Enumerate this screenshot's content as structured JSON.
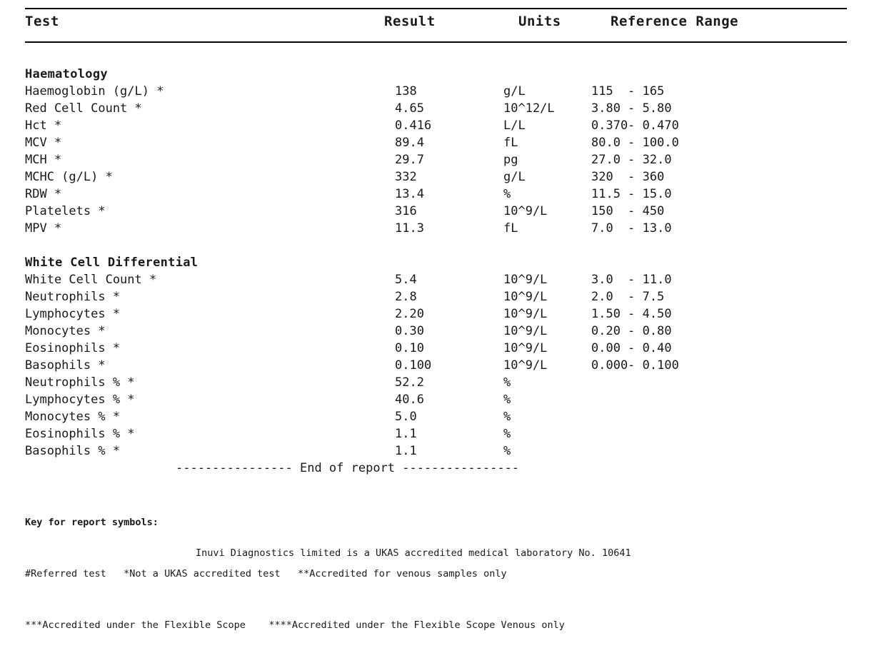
{
  "table": {
    "headers": {
      "test": "Test",
      "result": "Result",
      "units": "Units",
      "reference_range": "Reference Range"
    }
  },
  "sections": [
    {
      "title": "Haematology",
      "rows": [
        {
          "test": "Haemoglobin (g/L) *",
          "result": "138",
          "units": "g/L",
          "range": "115  - 165"
        },
        {
          "test": "Red Cell Count *",
          "result": "4.65",
          "units": "10^12/L",
          "range": "3.80 - 5.80"
        },
        {
          "test": "Hct *",
          "result": "0.416",
          "units": "L/L",
          "range": "0.370- 0.470"
        },
        {
          "test": "MCV *",
          "result": "89.4",
          "units": "fL",
          "range": "80.0 - 100.0"
        },
        {
          "test": "MCH *",
          "result": "29.7",
          "units": "pg",
          "range": "27.0 - 32.0"
        },
        {
          "test": "MCHC (g/L) *",
          "result": "332",
          "units": "g/L",
          "range": "320  - 360"
        },
        {
          "test": "RDW *",
          "result": "13.4",
          "units": "%",
          "range": "11.5 - 15.0"
        },
        {
          "test": "Platelets *",
          "result": "316",
          "units": "10^9/L",
          "range": "150  - 450"
        },
        {
          "test": "MPV *",
          "result": "11.3",
          "units": "fL",
          "range": "7.0  - 13.0"
        }
      ]
    },
    {
      "title": "White Cell Differential",
      "rows": [
        {
          "test": "White Cell Count *",
          "result": "5.4",
          "units": "10^9/L",
          "range": "3.0  - 11.0"
        },
        {
          "test": "Neutrophils *",
          "result": "2.8",
          "units": "10^9/L",
          "range": "2.0  - 7.5"
        },
        {
          "test": "Lymphocytes *",
          "result": "2.20",
          "units": "10^9/L",
          "range": "1.50 - 4.50"
        },
        {
          "test": "Monocytes *",
          "result": "0.30",
          "units": "10^9/L",
          "range": "0.20 - 0.80"
        },
        {
          "test": "Eosinophils *",
          "result": "0.10",
          "units": "10^9/L",
          "range": "0.00 - 0.40"
        },
        {
          "test": "Basophils *",
          "result": "0.100",
          "units": "10^9/L",
          "range": "0.000- 0.100"
        },
        {
          "test": "Neutrophils % *",
          "result": "52.2",
          "units": "%",
          "range": ""
        },
        {
          "test": "Lymphocytes % *",
          "result": "40.6",
          "units": "%",
          "range": ""
        },
        {
          "test": "Monocytes % *",
          "result": "5.0",
          "units": "%",
          "range": ""
        },
        {
          "test": "Eosinophils % *",
          "result": "1.1",
          "units": "%",
          "range": ""
        },
        {
          "test": "Basophils % *",
          "result": "1.1",
          "units": "%",
          "range": ""
        }
      ]
    }
  ],
  "end_of_report": "---------------- End of report ----------------",
  "footer": {
    "key_title": "Key for report symbols:",
    "key_line_1": "#Referred test   *Not a UKAS accredited test   **Accredited for venous samples only",
    "key_line_2": "***Accredited under the Flexible Scope    ****Accredited under the Flexible Scope Venous only",
    "accreditation": "Inuvi Diagnostics limited is a UKAS accredited medical laboratory No. 10641"
  }
}
